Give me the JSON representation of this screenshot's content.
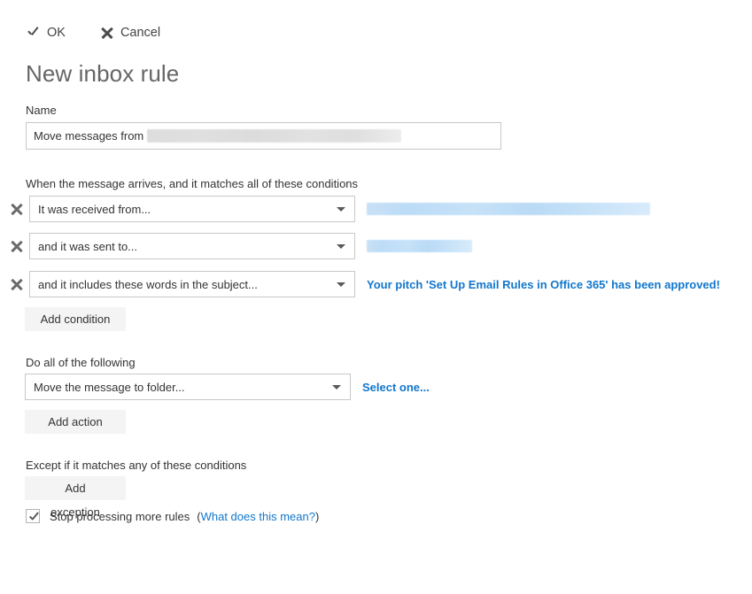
{
  "toolbar": {
    "ok_label": "OK",
    "ok_icon": "check-icon",
    "cancel_label": "Cancel",
    "cancel_icon": "close-icon"
  },
  "page_title": "New inbox rule",
  "name_section": {
    "label": "Name",
    "value_prefix": "Move messages from ",
    "value_redacted": true
  },
  "conditions": {
    "heading": "When the message arrives, and it matches all of these conditions",
    "rows": [
      {
        "remove_icon": "close-icon",
        "selected": "It was received from...",
        "caret_icon": "chevron-down-icon",
        "value_type": "redacted",
        "value_width": 320
      },
      {
        "remove_icon": "close-icon",
        "selected": "and it was sent to...",
        "caret_icon": "chevron-down-icon",
        "value_type": "redacted",
        "value_width": 119
      },
      {
        "remove_icon": "close-icon",
        "selected": "and it includes these words in the subject...",
        "caret_icon": "chevron-down-icon",
        "value_type": "text",
        "value_text": "Your pitch 'Set Up Email Rules in Office 365' has been approved!"
      }
    ],
    "add_button": "Add condition"
  },
  "actions": {
    "heading": "Do all of the following",
    "rows": [
      {
        "selected": "Move the message to folder...",
        "caret_icon": "chevron-down-icon",
        "value_type": "text",
        "value_text": "Select one..."
      }
    ],
    "add_button": "Add action"
  },
  "exceptions": {
    "heading": "Except if it matches any of these conditions",
    "add_button": "Add exception"
  },
  "stop_processing": {
    "checked": true,
    "label": "Stop processing more rules",
    "help_open_paren": "(",
    "help_link": "What does this mean?",
    "help_close_paren": ")"
  },
  "colors": {
    "link_blue": "#1277cc",
    "title_gray": "#666666",
    "text_gray": "#333333",
    "button_gray": "#f4f4f4",
    "border_gray": "#c8c8c8"
  }
}
